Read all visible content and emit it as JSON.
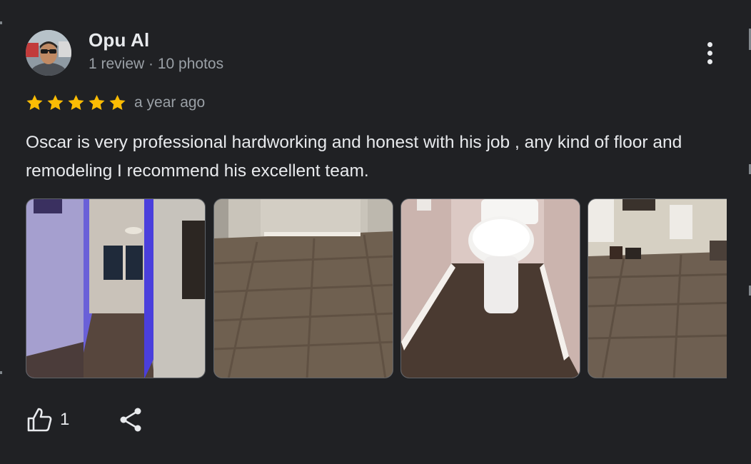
{
  "review": {
    "author_name": "Opu Al",
    "author_meta": "1 review · 10 photos",
    "rating": 5,
    "rating_max": 5,
    "time_ago": "a year ago",
    "text": "Oscar is very professional hardworking and honest with his job , any kind of floor and remodeling I recommend his excellent team.",
    "likes": "1",
    "photos": [
      {
        "name": "photo-hallway"
      },
      {
        "name": "photo-floor-room"
      },
      {
        "name": "photo-bathroom-toilet"
      },
      {
        "name": "photo-living-room"
      }
    ]
  },
  "icons": {
    "avatar": "avatar",
    "star": "star-icon",
    "more": "more-vert-icon",
    "like": "thumb-up-icon",
    "share": "share-icon"
  },
  "colors": {
    "background": "#202124",
    "text_primary": "#e8eaed",
    "text_secondary": "#9aa0a6",
    "star": "#fbbc04"
  }
}
